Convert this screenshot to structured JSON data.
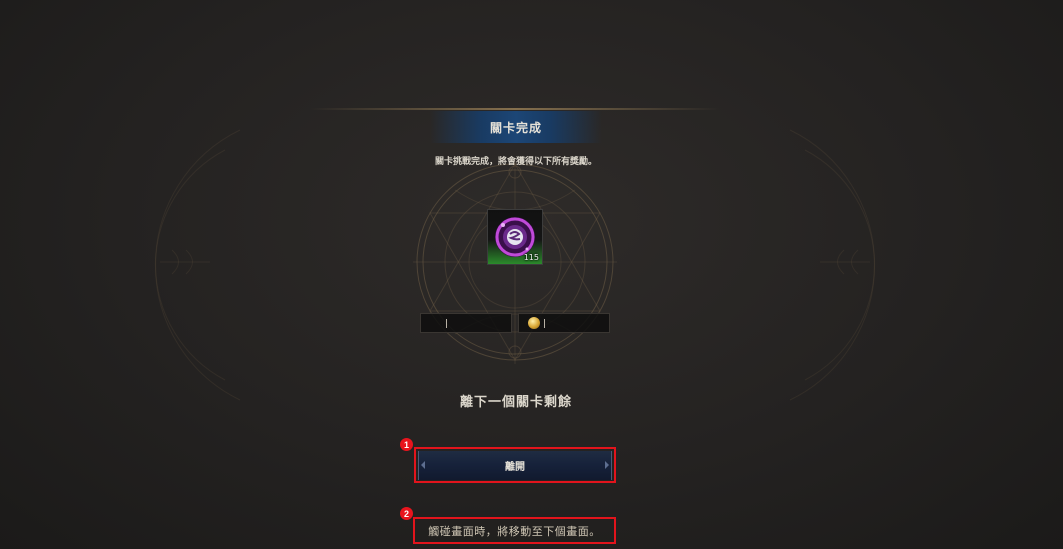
{
  "header": {
    "title": "關卡完成"
  },
  "subtitle": "關卡挑戰完成，將會獲得以下所有獎勵。",
  "reward": {
    "count": "115",
    "icon": "purple-orb-icon"
  },
  "resources": {
    "left_value": "",
    "right_value": "",
    "right_icon": "gold-coin-icon"
  },
  "next_stage_label": "離下一個關卡剩餘",
  "buttons": {
    "leave_label": "離開"
  },
  "hint": {
    "tap_text": "觸碰畫面時，將移動至下個畫面。"
  },
  "annotations": {
    "marker_1": "1",
    "marker_2": "2"
  },
  "colors": {
    "banner_blue": "#1c4676",
    "highlight_red": "#e2141c",
    "background": "#242221"
  }
}
